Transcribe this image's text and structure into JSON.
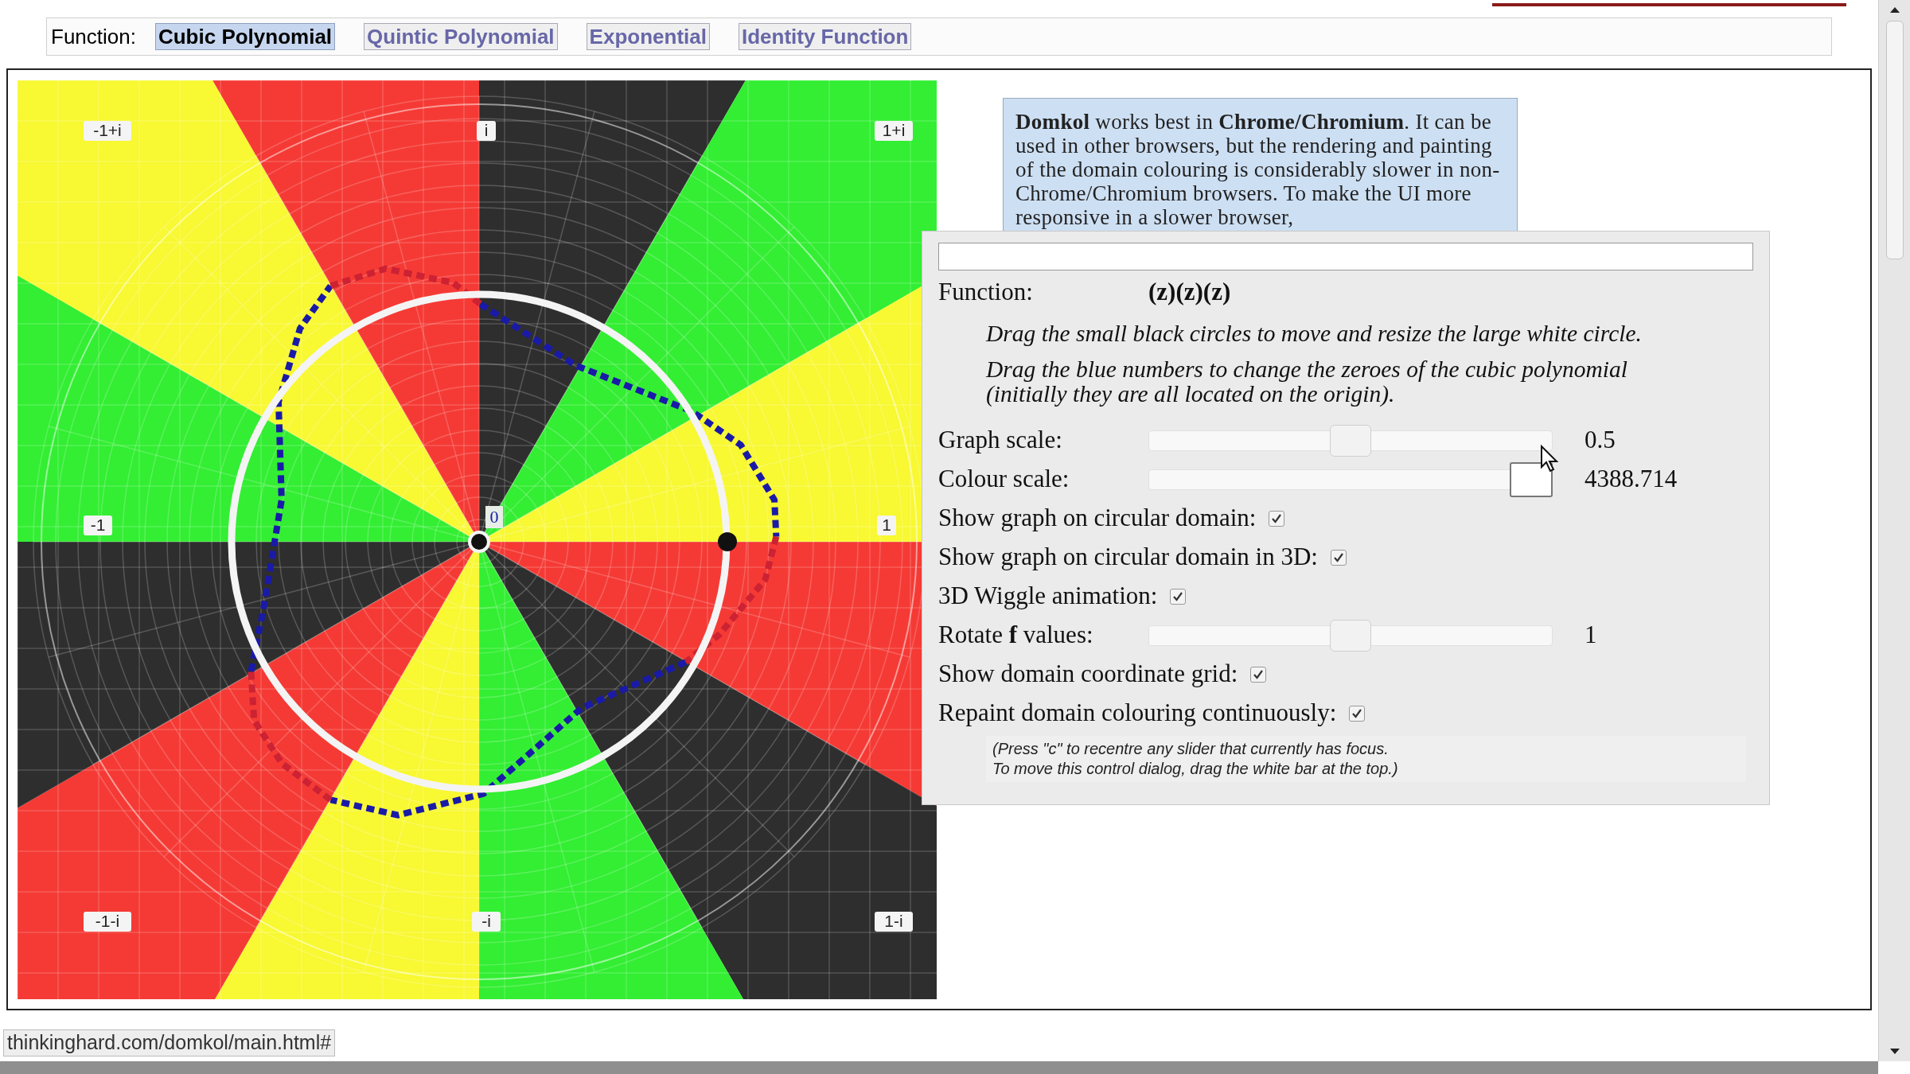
{
  "function_bar": {
    "label": "Function:",
    "tabs": [
      {
        "label": "Cubic Polynomial",
        "selected": true
      },
      {
        "label": "Quintic Polynomial",
        "selected": false
      },
      {
        "label": "Exponential",
        "selected": false
      },
      {
        "label": "Identity Function",
        "selected": false
      }
    ]
  },
  "plot": {
    "axis_labels": [
      "-1+i",
      "i",
      "1+i",
      "-1",
      "1",
      "-1-i",
      "-i",
      "1-i"
    ],
    "zero_label": "0"
  },
  "notice": {
    "text": "**Domkol** works best in **Chrome/Chromium**. It can be used in other browsers, but the rendering and painting of the domain colouring is considerably slower in non-Chrome/Chromium browsers. To make the UI more responsive in a slower browser,"
  },
  "dialog": {
    "function_label": "Function:",
    "function_value": "(z)(z)(z)",
    "instructions": [
      "Drag the small black circles to move and resize the large white circle.",
      "Drag the blue numbers to change the zeroes of the cubic polynomial (initially they are all located on the origin)."
    ],
    "controls": [
      {
        "kind": "slider",
        "label": "Graph scale:",
        "level": 0.5,
        "reading": "0.5",
        "focused": false
      },
      {
        "kind": "slider",
        "label": "Colour scale:",
        "level": 1,
        "reading": "4388.714",
        "focused": true
      },
      {
        "kind": "checkbox",
        "label": "Show graph on circular domain:",
        "checked": true
      },
      {
        "kind": "checkbox",
        "label": "Show graph on circular domain in 3D:",
        "checked": true
      },
      {
        "kind": "checkbox",
        "label": "3D Wiggle animation:",
        "checked": true
      },
      {
        "kind": "slider",
        "label": "Rotate **f** values:",
        "level": 0.5,
        "reading": "1",
        "focused": false
      },
      {
        "kind": "checkbox",
        "label": "Show domain coordinate grid:",
        "checked": true
      },
      {
        "kind": "checkbox",
        "label": "Repaint domain colouring continuously:",
        "checked": true
      }
    ],
    "footnote": [
      "(Press \"c\" to recentre any slider that currently has focus.",
      "To move this control dialog, drag the white bar at the top.)"
    ]
  },
  "status_bar": {
    "url": "thinkinghard.com/domkol/main.html#"
  }
}
